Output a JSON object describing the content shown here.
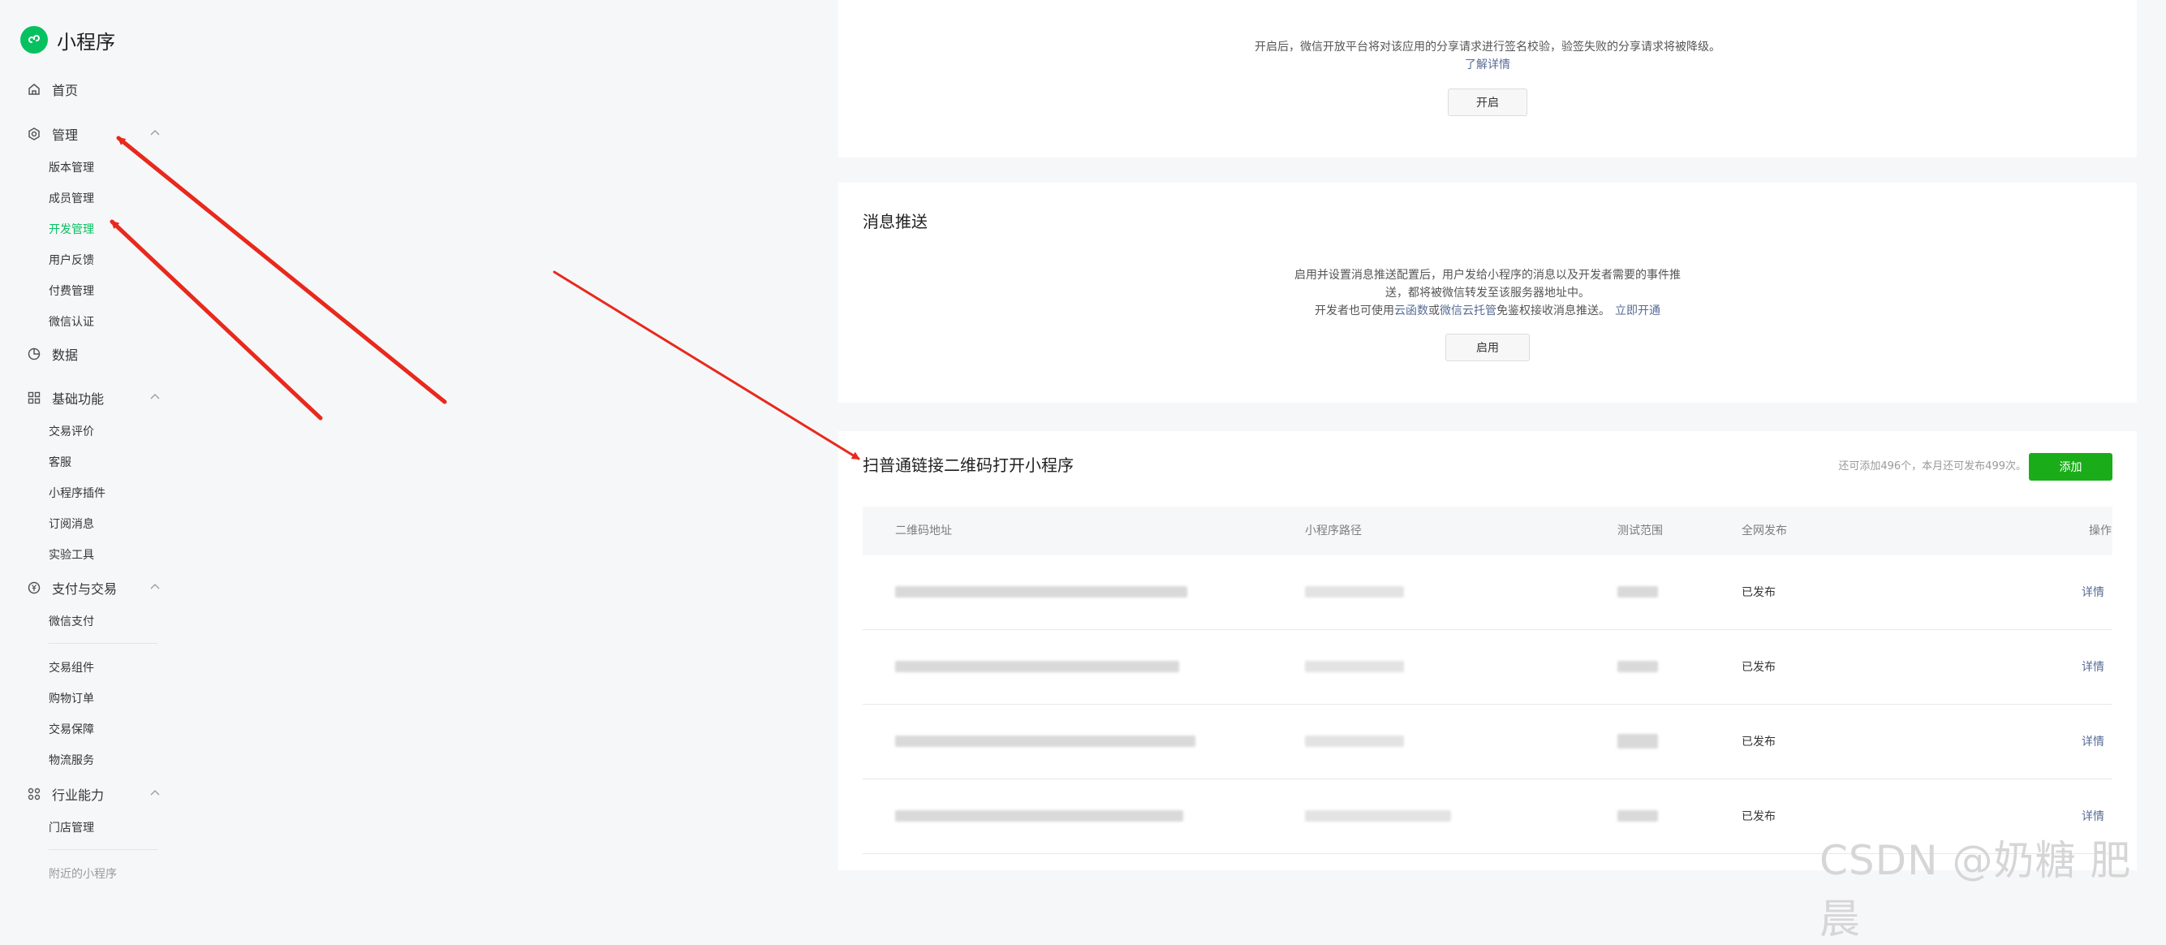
{
  "app": {
    "title": "小程序",
    "brand_color": "#07c160"
  },
  "sidebar": {
    "home": "首页",
    "manage": {
      "label": "管理",
      "items": [
        "版本管理",
        "成员管理",
        "开发管理",
        "用户反馈",
        "付费管理",
        "微信认证"
      ]
    },
    "data": "数据",
    "basic": {
      "label": "基础功能",
      "items": [
        "交易评价",
        "客服",
        "小程序插件",
        "订阅消息",
        "实验工具"
      ]
    },
    "pay": {
      "label": "支付与交易",
      "items": [
        "微信支付",
        "交易组件",
        "购物订单",
        "交易保障",
        "物流服务"
      ]
    },
    "industry": {
      "label": "行业能力",
      "items": [
        "门店管理",
        "附近的小程序"
      ]
    }
  },
  "share_card": {
    "desc": "开启后，微信开放平台将对该应用的分享请求进行签名校验，验签失败的分享请求将被降级。",
    "learn_more": "了解详情",
    "enable_button": "开启"
  },
  "push_card": {
    "title": "消息推送",
    "desc_line1": "启用并设置消息推送配置后，用户发给小程序的消息以及开发者需要的事件推",
    "desc_line2": "送，都将被微信转发至该服务器地址中。",
    "desc_line3_prefix": "开发者也可使用",
    "cloud_func": "云函数",
    "or": "或",
    "cloud_hosting": "微信云托管",
    "desc_line3_suffix": "免鉴权接收消息推送。",
    "open_now": "立即开通",
    "enable_button": "启用"
  },
  "qr_card": {
    "title": "扫普通链接二维码打开小程序",
    "quota": "还可添加496个，本月还可发布499次。",
    "add_button": "添加",
    "columns": [
      "二维码地址",
      "小程序路径",
      "测试范围",
      "全网发布",
      "操作"
    ],
    "rows": [
      {
        "status": "已发布",
        "action": "详情"
      },
      {
        "status": "已发布",
        "action": "详情"
      },
      {
        "status": "已发布",
        "action": "详情"
      },
      {
        "status": "已发布",
        "action": "详情"
      }
    ]
  },
  "watermark": "CSDN @奶糖 肥晨",
  "colors": {
    "primary_green": "#1aad19",
    "link_blue": "#576b95",
    "annotation_red": "#e8291c"
  }
}
